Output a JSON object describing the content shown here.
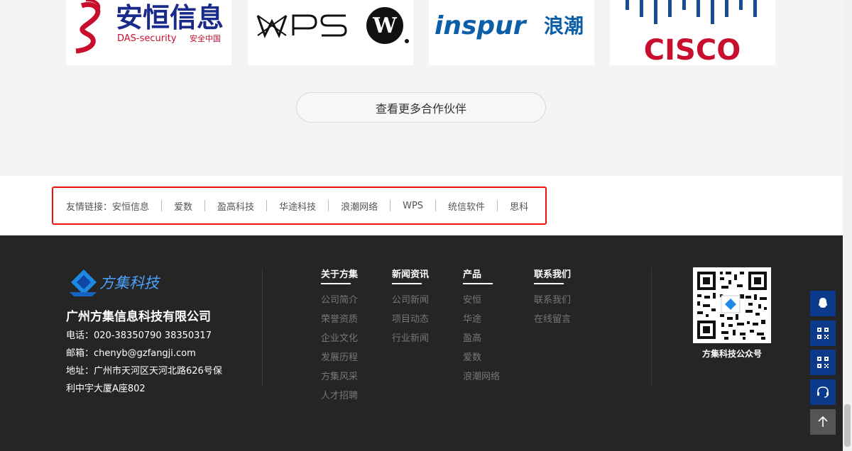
{
  "partners": {
    "logos": [
      {
        "name": "安恒信息",
        "subtitle": "DAS-security",
        "tag": "安全中国"
      },
      {
        "name": "WPS"
      },
      {
        "name": "inspur",
        "cn": "浪潮"
      },
      {
        "name": "CISCO"
      }
    ],
    "more_button": "查看更多合作伙伴"
  },
  "links": {
    "label": "友情链接：",
    "items": [
      "安恒信息",
      "爱数",
      "盈高科技",
      "华途科技",
      "浪潮网络",
      "WPS",
      "统信软件",
      "思科"
    ]
  },
  "footer": {
    "logo_text": "方集科技",
    "company": "广州方集信息科技有限公司",
    "phone": "电话：020-38350790  38350317",
    "email": "邮箱：chenyb@gzfangji.com",
    "address_1": "地址：广州市天河区天河北路626号保",
    "address_2": "利中宇大厦A座802",
    "columns": [
      {
        "title": "关于方集",
        "items": [
          "公司简介",
          "荣誉资质",
          "企业文化",
          "发展历程",
          "方集风采",
          "人才招聘"
        ]
      },
      {
        "title": "新闻资讯",
        "items": [
          "公司新闻",
          "项目动态",
          "行业新闻"
        ]
      },
      {
        "title": "产品",
        "items": [
          "安恒",
          "华途",
          "盈高",
          "爱数",
          "浪潮网络"
        ]
      },
      {
        "title": "联系我们",
        "items": [
          "联系我们",
          "在线留言"
        ]
      }
    ],
    "qr_caption": "方集科技公众号"
  },
  "side_toolbar": {
    "icons": [
      "qq-icon",
      "qr-code-icon",
      "qr-code-icon",
      "headset-icon",
      "arrow-up-icon"
    ]
  },
  "colors": {
    "footer_bg": "#252525",
    "side_button": "#0b3a8c",
    "highlight_border": "#ee1111"
  }
}
